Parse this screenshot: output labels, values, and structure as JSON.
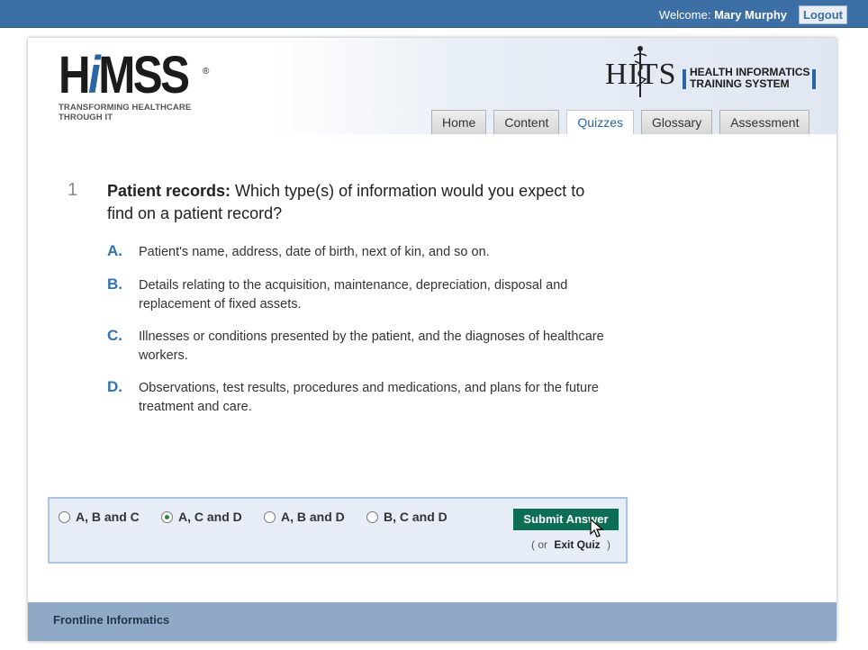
{
  "topbar": {
    "welcome_label": "Welcome:",
    "user_name": "Mary Murphy",
    "logout_label": "Logout"
  },
  "branding": {
    "himss_prefix": "H",
    "himss_ital": "i",
    "himss_suffix": "MSS",
    "himss_reg": "®",
    "himss_tagline_1": "TRANSFORMING HEALTHCARE",
    "himss_tagline_2": "THROUGH IT",
    "hits_word": "HITS",
    "hits_line1": "HEALTH INFORMATICS",
    "hits_line2": "TRAINING SYSTEM"
  },
  "nav": {
    "tabs": [
      {
        "label": "Home",
        "active": false
      },
      {
        "label": "Content",
        "active": false
      },
      {
        "label": "Quizzes",
        "active": true
      },
      {
        "label": "Glossary",
        "active": false
      },
      {
        "label": "Assessment",
        "active": false
      }
    ]
  },
  "question": {
    "number": "1",
    "topic": "Patient records:",
    "text": " Which type(s) of information would you expect to find on a patient record?",
    "answers": [
      {
        "letter": "A.",
        "text": "Patient's name, address, date of birth, next of kin, and so on."
      },
      {
        "letter": "B.",
        "text": "Details relating to the acquisition, maintenance, depreciation, disposal and replacement of fixed assets."
      },
      {
        "letter": "C.",
        "text": "Illnesses or conditions presented by the patient, and the diagnoses of healthcare workers."
      },
      {
        "letter": "D.",
        "text": "Observations, test results, procedures and medications, and plans for the future treatment and care."
      }
    ]
  },
  "options": {
    "choices": [
      {
        "label": "A, B and C",
        "selected": false
      },
      {
        "label": "A, C and D",
        "selected": true
      },
      {
        "label": "A, B and D",
        "selected": false
      },
      {
        "label": "B, C and D",
        "selected": false
      }
    ],
    "submit_label": "Submit Answer",
    "or_open": "( or",
    "exit_label": "Exit Quiz",
    "or_close": ")"
  },
  "footer": {
    "text": "Frontline Informatics"
  },
  "colors": {
    "topbar": "#3b6fa6",
    "accent": "#2866a8",
    "submit": "#0c6e55",
    "footer": "#8fa9c6"
  }
}
